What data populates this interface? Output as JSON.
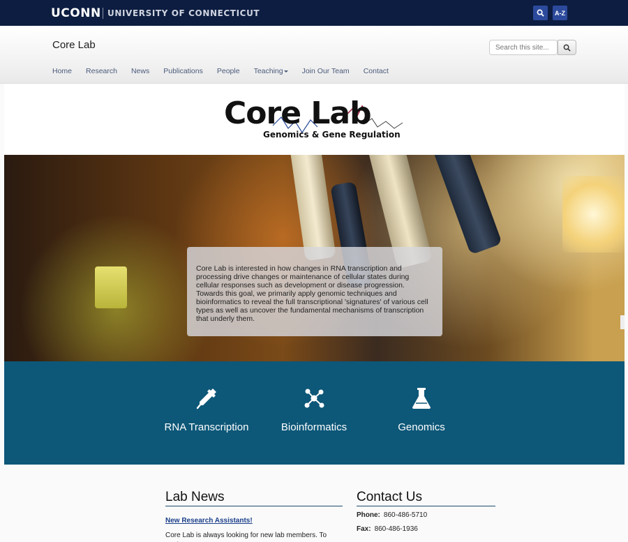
{
  "university_banner": {
    "wordmark": "UCONN",
    "university_name": "UNIVERSITY OF CONNECTICUT",
    "az_label": "A-Z",
    "background_color": "#0d1d41"
  },
  "site": {
    "title": "Core Lab",
    "search_placeholder": "Search this site..."
  },
  "nav": {
    "items": [
      {
        "label": "Home"
      },
      {
        "label": "Research"
      },
      {
        "label": "News"
      },
      {
        "label": "Publications"
      },
      {
        "label": "People"
      },
      {
        "label": "Teaching",
        "has_dropdown": true
      },
      {
        "label": "Join Our Team"
      },
      {
        "label": "Contact"
      }
    ]
  },
  "logo": {
    "main_text": "Core Lab",
    "subtitle": "Genomics & Gene Regulation"
  },
  "hero": {
    "text": "Core Lab is interested in how changes in RNA transcription and processing drive changes or maintenance of cellular states during cellular responses such as development or disease progression. Towards this goal, we primarily apply genomic techniques and bioinformatics to reveal the full transcriptional 'signatures' of various cell types as well as uncover the fundamental mechanisms of transcription that underly them."
  },
  "topics": {
    "background_color": "#0d5778",
    "items": [
      {
        "label": "RNA Transcription",
        "icon": "dropper-icon"
      },
      {
        "label": "Bioinformatics",
        "icon": "network-icon"
      },
      {
        "label": "Genomics",
        "icon": "flask-icon"
      }
    ]
  },
  "lab_news": {
    "heading": "Lab News",
    "item_title": "New Research Assistants!",
    "item_excerpt": "Core Lab is always looking for new lab members. To apply"
  },
  "contact": {
    "heading": "Contact Us",
    "phone_label": "Phone:",
    "phone": "860-486-5710",
    "fax_label": "Fax:",
    "fax": "860-486-1936"
  }
}
